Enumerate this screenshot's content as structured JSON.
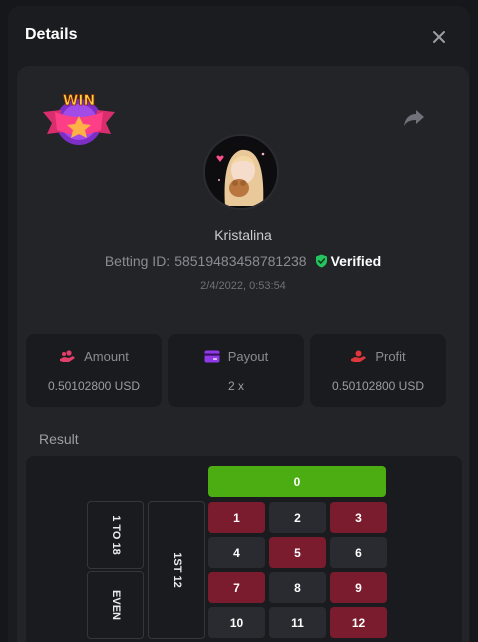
{
  "modal": {
    "title": "Details"
  },
  "badge": {
    "text": "WIN"
  },
  "user": {
    "name": "Kristalina"
  },
  "bet": {
    "id_label": "Betting ID:",
    "id_value": "58519483458781238",
    "verified_label": "Verified",
    "date": "2/4/2022, 0:53:54"
  },
  "stats": {
    "amount": {
      "label": "Amount",
      "value": "0.50102800 USD"
    },
    "payout": {
      "label": "Payout",
      "value": "2 x"
    },
    "profit": {
      "label": "Profit",
      "value": "0.50102800 USD"
    }
  },
  "result": {
    "label": "Result",
    "zero": "0",
    "dozen_label": "1ST 12",
    "range_label": "1 TO 18",
    "parity_label": "EVEN",
    "rows": [
      [
        {
          "n": "1",
          "c": "red"
        },
        {
          "n": "2",
          "c": "black"
        },
        {
          "n": "3",
          "c": "red"
        }
      ],
      [
        {
          "n": "4",
          "c": "black"
        },
        {
          "n": "5",
          "c": "red"
        },
        {
          "n": "6",
          "c": "black"
        }
      ],
      [
        {
          "n": "7",
          "c": "red"
        },
        {
          "n": "8",
          "c": "black"
        },
        {
          "n": "9",
          "c": "red"
        }
      ],
      [
        {
          "n": "10",
          "c": "black"
        },
        {
          "n": "11",
          "c": "black"
        },
        {
          "n": "12",
          "c": "red"
        }
      ]
    ]
  },
  "colors": {
    "red": "#7a1c2e",
    "black": "#2a2b30",
    "green": "#4cad12",
    "verified": "#22c55e",
    "icon_pink": "#e2406a",
    "icon_purple": "#8f39e8",
    "icon_red": "#e0363c"
  },
  "icons": {
    "close": "close-icon",
    "share": "share-icon",
    "amount": "coins-hand-icon",
    "payout": "wallet-card-icon",
    "profit": "profit-hand-icon",
    "verified": "shield-check-icon"
  }
}
